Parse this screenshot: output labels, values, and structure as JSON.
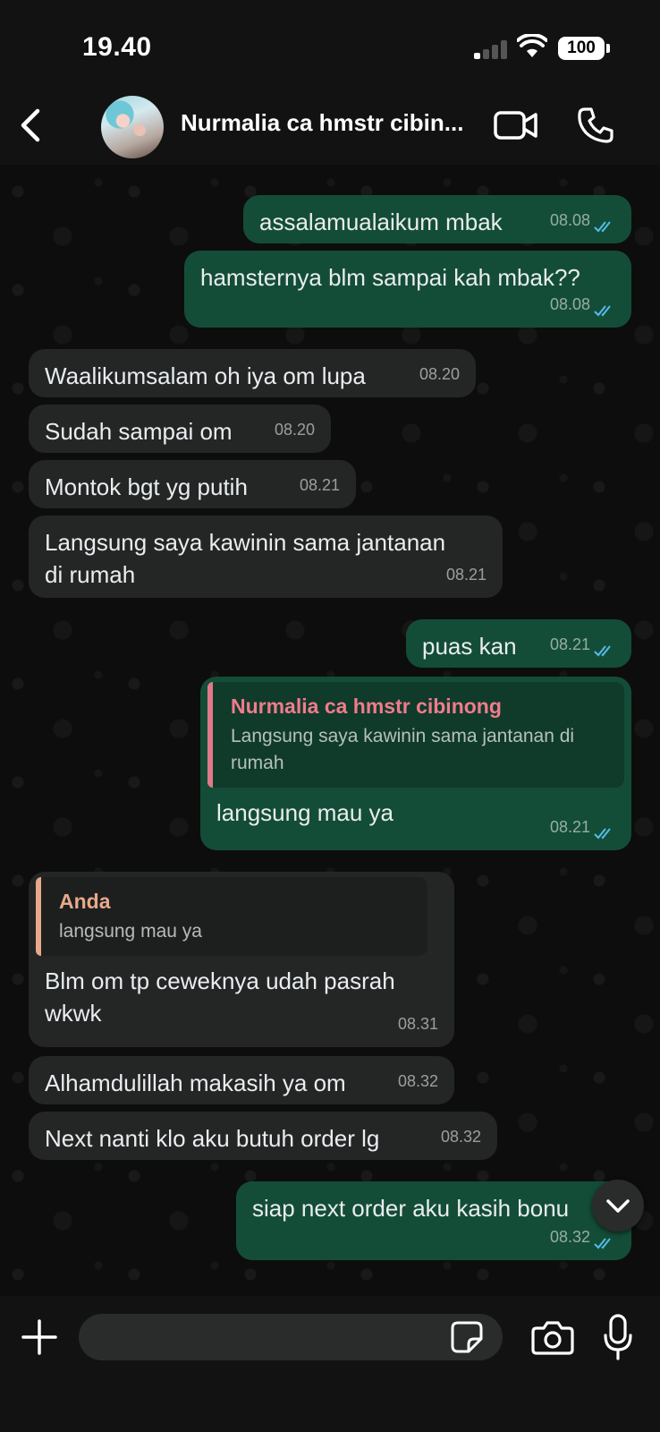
{
  "status_bar": {
    "time": "19.40",
    "battery": "100"
  },
  "header": {
    "contact_name": "Nurmalia ca hmstr cibin..."
  },
  "messages": [
    {
      "type": "out",
      "text": "assalamualaikum mbak",
      "time": "08.08"
    },
    {
      "type": "out",
      "text": "hamsternya blm sampai kah mbak??",
      "time": "08.08"
    },
    {
      "type": "in",
      "text": "Waalikumsalam oh iya om lupa",
      "time": "08.20"
    },
    {
      "type": "in",
      "text": "Sudah sampai om",
      "time": "08.20"
    },
    {
      "type": "in",
      "text": "Montok bgt yg putih",
      "time": "08.21"
    },
    {
      "type": "in",
      "text": "Langsung saya kawinin sama jantanan di rumah",
      "time": "08.21"
    },
    {
      "type": "out",
      "text": "puas kan",
      "time": "08.21"
    },
    {
      "type": "out",
      "text": "langsung mau ya",
      "time": "08.21",
      "quote": {
        "author": "Nurmalia ca hmstr cibinong",
        "text": "Langsung saya kawinin sama jantanan di rumah"
      }
    },
    {
      "type": "in",
      "text": "Blm om tp ceweknya udah pasrah wkwk",
      "time": "08.31",
      "quote": {
        "author": "Anda",
        "text": "langsung mau ya"
      }
    },
    {
      "type": "in",
      "text": "Alhamdulillah makasih ya om",
      "time": "08.32"
    },
    {
      "type": "in",
      "text": "Next nanti klo aku butuh order lg",
      "time": "08.32"
    },
    {
      "type": "out",
      "text": "siap next order aku kasih bonu",
      "time": "08.32"
    }
  ],
  "icons": {
    "back": "chevron-left-icon",
    "video": "video-camera-icon",
    "call": "phone-icon",
    "read_receipt": "double-check-icon",
    "scroll_down": "chevron-down-icon",
    "attach": "plus-icon",
    "sticker": "sticker-icon",
    "camera": "camera-icon",
    "mic": "microphone-icon"
  },
  "colors": {
    "outgoing_bubble": "#144d37",
    "incoming_bubble": "#242626",
    "read_tick": "#53bdeb",
    "quote_author_contact": "#f07c8c",
    "quote_author_self": "#e8a98a"
  },
  "input": {
    "value": "",
    "placeholder": ""
  }
}
